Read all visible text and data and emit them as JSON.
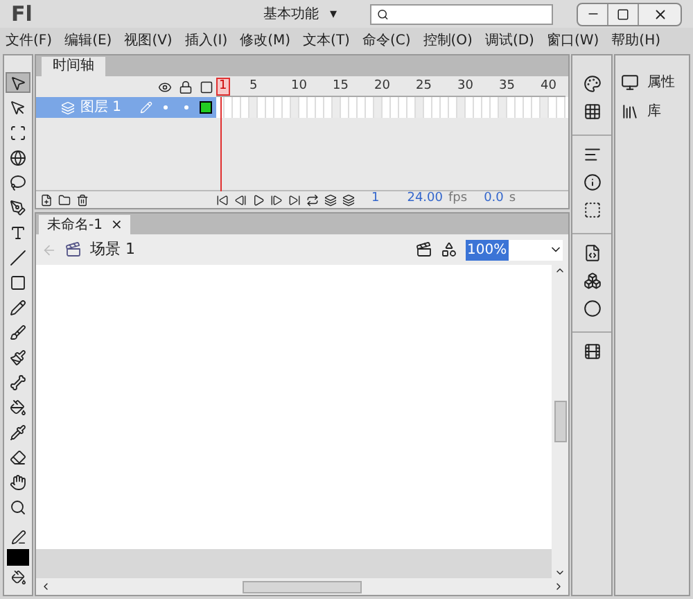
{
  "app": {
    "logo": "Fl",
    "workspace": "基本功能",
    "workspace_caret": "▾"
  },
  "menu": [
    "文件(F)",
    "编辑(E)",
    "视图(V)",
    "插入(I)",
    "修改(M)",
    "文本(T)",
    "命令(C)",
    "控制(O)",
    "调试(D)",
    "窗口(W)",
    "帮助(H)"
  ],
  "timeline": {
    "tab": "时间轴",
    "frame_labels": [
      "1",
      "5",
      "10",
      "15",
      "20",
      "25",
      "30",
      "35",
      "40"
    ],
    "layers": [
      {
        "name": "图层 1",
        "selected": true,
        "color": "#22cc22"
      }
    ],
    "status": {
      "frame": "1",
      "fps": "24.00",
      "fps_unit": "fps",
      "time": "0.0",
      "time_unit": "s"
    }
  },
  "document": {
    "tab": "未命名-1",
    "close": "×",
    "scene": "场景 1",
    "zoom": "100%"
  },
  "tools": [
    {
      "kind": "select",
      "selected": true
    },
    {
      "kind": "subselect",
      "selected": false
    },
    {
      "kind": "transform",
      "selected": false
    },
    {
      "kind": "rotate3d",
      "selected": false
    },
    {
      "kind": "lasso",
      "selected": false
    },
    {
      "kind": "pen",
      "selected": false
    },
    {
      "kind": "text",
      "selected": false
    },
    {
      "kind": "line",
      "selected": false
    },
    {
      "kind": "rect",
      "selected": false
    },
    {
      "kind": "pencil",
      "selected": false
    },
    {
      "kind": "brush",
      "selected": false
    },
    {
      "kind": "deco",
      "selected": false
    },
    {
      "kind": "bone",
      "selected": false
    },
    {
      "kind": "bucket",
      "selected": false
    },
    {
      "kind": "eyedropper",
      "selected": false
    },
    {
      "kind": "eraser",
      "selected": false
    },
    {
      "kind": "hand",
      "selected": false
    },
    {
      "kind": "zoom",
      "selected": false
    }
  ],
  "panels": [
    {
      "label": "属性",
      "kind": "properties"
    },
    {
      "label": "库",
      "kind": "library"
    }
  ]
}
